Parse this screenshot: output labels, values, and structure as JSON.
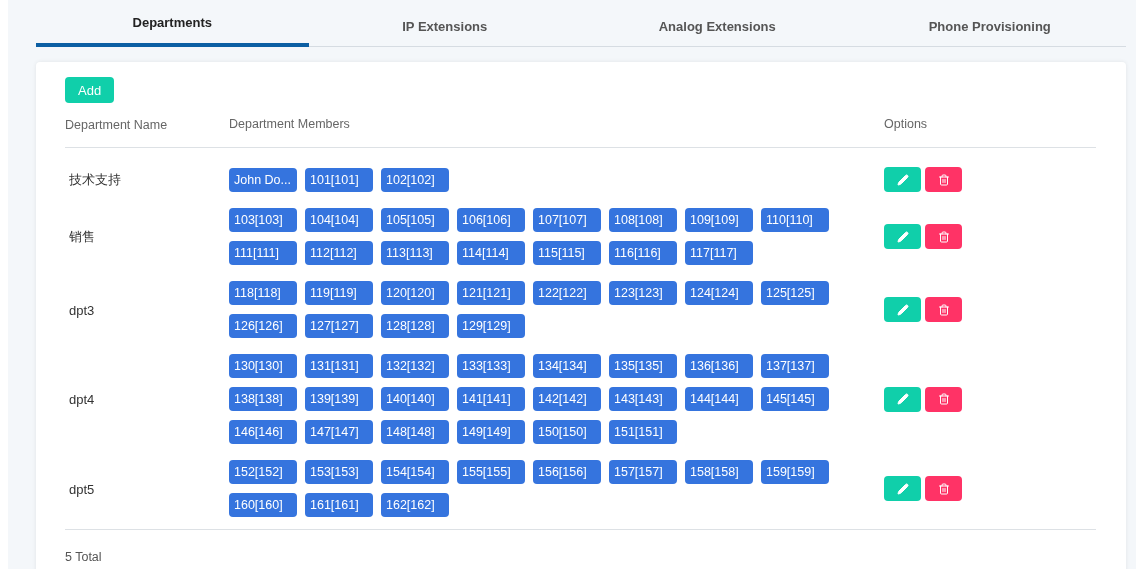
{
  "tabs": [
    {
      "label": "Departments",
      "selected": true
    },
    {
      "label": "IP Extensions",
      "selected": false
    },
    {
      "label": "Analog Extensions",
      "selected": false
    },
    {
      "label": "Phone Provisioning",
      "selected": false
    }
  ],
  "add_button": "Add",
  "table": {
    "columns": [
      "Department Name",
      "Department Members",
      "Options"
    ],
    "rows": [
      {
        "name": "技术支持",
        "members": [
          "John Do...",
          "101[101]",
          "102[102]"
        ]
      },
      {
        "name": "销售",
        "members": [
          "103[103]",
          "104[104]",
          "105[105]",
          "106[106]",
          "107[107]",
          "108[108]",
          "109[109]",
          "110[110]",
          "111[111]",
          "112[112]",
          "113[113]",
          "114[114]",
          "115[115]",
          "116[116]",
          "117[117]"
        ]
      },
      {
        "name": "dpt3",
        "members": [
          "118[118]",
          "119[119]",
          "120[120]",
          "121[121]",
          "122[122]",
          "123[123]",
          "124[124]",
          "125[125]",
          "126[126]",
          "127[127]",
          "128[128]",
          "129[129]"
        ]
      },
      {
        "name": "dpt4",
        "members": [
          "130[130]",
          "131[131]",
          "132[132]",
          "133[133]",
          "134[134]",
          "135[135]",
          "136[136]",
          "137[137]",
          "138[138]",
          "139[139]",
          "140[140]",
          "141[141]",
          "142[142]",
          "143[143]",
          "144[144]",
          "145[145]",
          "146[146]",
          "147[147]",
          "148[148]",
          "149[149]",
          "150[150]",
          "151[151]"
        ]
      },
      {
        "name": "dpt5",
        "members": [
          "152[152]",
          "153[153]",
          "154[154]",
          "155[155]",
          "156[156]",
          "157[157]",
          "158[158]",
          "159[159]",
          "160[160]",
          "161[161]",
          "162[162]"
        ]
      }
    ]
  },
  "total": "5 Total"
}
